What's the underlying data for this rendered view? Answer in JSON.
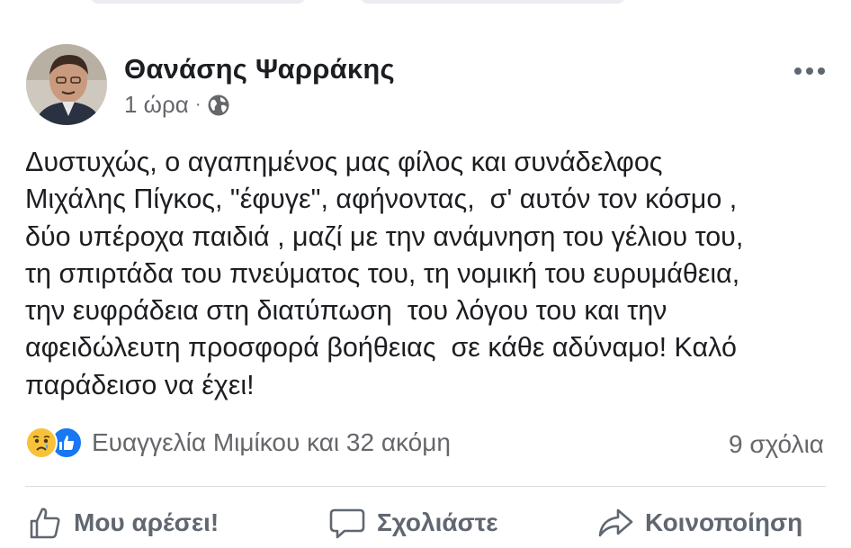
{
  "post": {
    "author": "Θανάσης Ψαρράκης",
    "time": "1 ώρα",
    "separator": "·",
    "privacy_icon": "globe-icon",
    "more_icon": "more-options-icon",
    "text": "Δυστυχώς, ο αγαπημένος μας φίλος και συνάδελφος\nΜιχάλης Πίγκος, \"έφυγε\", αφήνοντας,  σ' αυτόν τον κόσμο ,\nδύο υπέροχα παιδιά , μαζί με την ανάμνηση του γέλιου του,\nτη σπιρτάδα του πνεύματος του, τη νομική του ευρυμάθεια,\nτην ευφράδεια στη διατύπωση  του λόγου του και την\nαφειδώλευτη προσφορά βοήθειας  σε κάθε αδύναμο! Καλό\nπαράδεισο να έχει!"
  },
  "reactions": {
    "icons": [
      "sad-reaction-icon",
      "like-reaction-icon"
    ],
    "summary": "Ευαγγελία Μιμίκου και 32 ακόμη",
    "comments": "9 σχόλια"
  },
  "actions": {
    "like": "Μου αρέσει!",
    "comment": "Σχολιάστε",
    "share": "Κοινοποίηση"
  },
  "colors": {
    "secondary_text": "#65676b",
    "like_blue": "#1877f2",
    "sad_yellow": "#f7c23a",
    "divider": "#dadde1"
  }
}
